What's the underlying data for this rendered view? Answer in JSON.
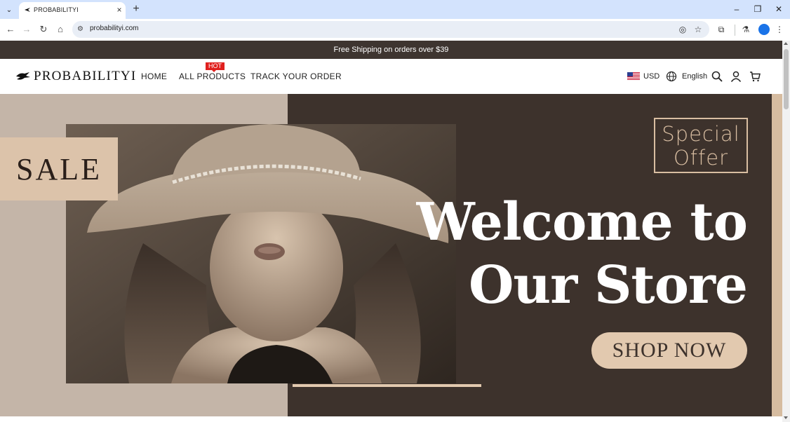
{
  "browser": {
    "tab_title": "PROBABILITYI",
    "url": "probabilityi.com"
  },
  "announcement": "Free Shipping on orders over $39",
  "header": {
    "logo_text": "PROBABILITYI",
    "nav": [
      "HOME",
      "ALL PRODUCTS",
      "TRACK YOUR ORDER"
    ],
    "hot_badge": "HOT",
    "currency": "USD",
    "language": "English"
  },
  "hero": {
    "sale": "SALE",
    "special_line1": "Special",
    "special_line2": "Offer",
    "welcome_line1": "Welcome to",
    "welcome_line2": "Our Store",
    "shop_now": "SHOP NOW"
  },
  "colors": {
    "announcement_bg": "#3e3530",
    "hero_dark": "#3d322c",
    "hero_light": "#c4b5a8",
    "accent_tan": "#e2c9af",
    "hot_red": "#e0201e"
  }
}
